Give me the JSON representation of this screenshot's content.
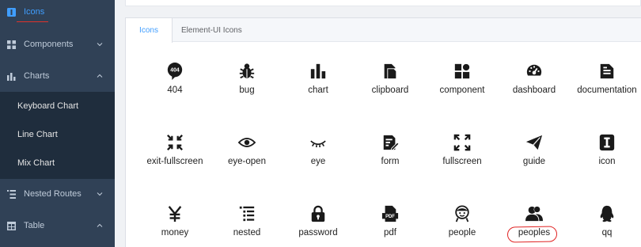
{
  "sidebar": {
    "items": [
      {
        "label": "Icons",
        "icon": "icon-square-icon",
        "active": true
      },
      {
        "label": "Components",
        "icon": "grid-icon",
        "arrow": "down"
      },
      {
        "label": "Charts",
        "icon": "bar-chart-icon",
        "arrow": "up"
      },
      {
        "label": "Nested Routes",
        "icon": "list-icon",
        "arrow": "down"
      },
      {
        "label": "Table",
        "icon": "table-icon",
        "arrow": "up"
      }
    ],
    "charts_children": [
      "Keyboard Chart",
      "Line Chart",
      "Mix Chart"
    ]
  },
  "tabs": [
    {
      "label": "Icons",
      "active": true
    },
    {
      "label": "Element-UI Icons",
      "active": false
    }
  ],
  "icons": [
    {
      "name": "404",
      "icon": "404-icon"
    },
    {
      "name": "bug",
      "icon": "bug-icon"
    },
    {
      "name": "chart",
      "icon": "chart-icon"
    },
    {
      "name": "clipboard",
      "icon": "clipboard-icon"
    },
    {
      "name": "component",
      "icon": "component-icon"
    },
    {
      "name": "dashboard",
      "icon": "dashboard-icon"
    },
    {
      "name": "documentation",
      "icon": "documentation-icon"
    },
    {
      "name": "exit-fullscreen",
      "icon": "exit-fullscreen-icon"
    },
    {
      "name": "eye-open",
      "icon": "eye-open-icon"
    },
    {
      "name": "eye",
      "icon": "eye-icon"
    },
    {
      "name": "form",
      "icon": "form-icon"
    },
    {
      "name": "fullscreen",
      "icon": "fullscreen-icon"
    },
    {
      "name": "guide",
      "icon": "guide-icon"
    },
    {
      "name": "icon",
      "icon": "icon-icon"
    },
    {
      "name": "money",
      "icon": "money-icon"
    },
    {
      "name": "nested",
      "icon": "nested-icon"
    },
    {
      "name": "password",
      "icon": "password-icon"
    },
    {
      "name": "pdf",
      "icon": "pdf-icon"
    },
    {
      "name": "people",
      "icon": "people-icon"
    },
    {
      "name": "peoples",
      "icon": "peoples-icon"
    },
    {
      "name": "qq",
      "icon": "qq-icon"
    }
  ],
  "colors": {
    "sidebar_bg": "#304156",
    "submenu_bg": "#1f2d3d",
    "accent": "#409eff",
    "annotation_red": "#e02424"
  }
}
